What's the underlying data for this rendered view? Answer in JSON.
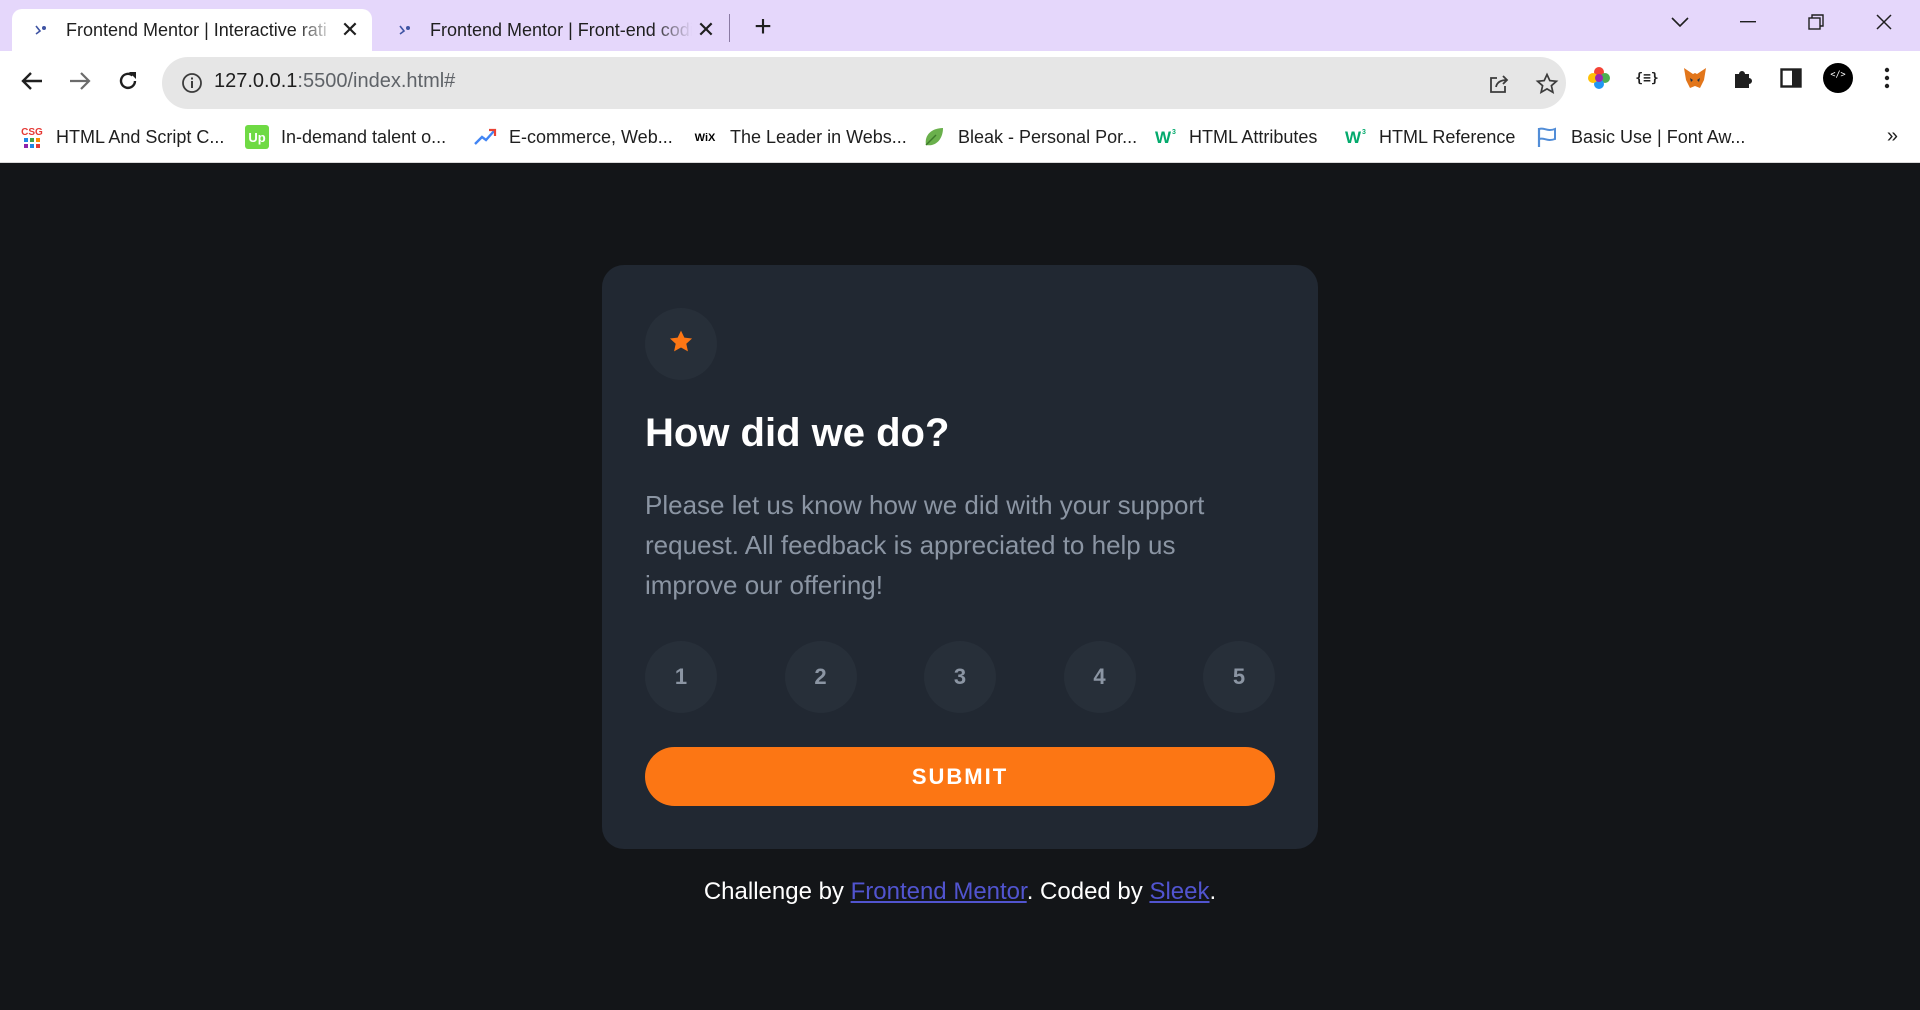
{
  "browser": {
    "tabs": [
      {
        "title": "Frontend Mentor | Interactive rati",
        "active": true
      },
      {
        "title": "Frontend Mentor | Front-end codi",
        "active": false
      }
    ],
    "address_host": "127.0.0.1",
    "address_rest": ":5500/index.html#",
    "bookmarks": [
      {
        "label": "HTML And Script C...",
        "icon": "csg-icon"
      },
      {
        "label": "In-demand talent o...",
        "icon": "upwork-icon"
      },
      {
        "label": "E-commerce, Web...",
        "icon": "trend-icon"
      },
      {
        "label": "The Leader in Webs...",
        "icon": "wix-icon"
      },
      {
        "label": "Bleak - Personal Por...",
        "icon": "leaf-icon"
      },
      {
        "label": "HTML Attributes",
        "icon": "w3schools-icon"
      },
      {
        "label": "HTML Reference",
        "icon": "w3schools-icon"
      },
      {
        "label": "Basic Use | Font Aw...",
        "icon": "flag-icon"
      }
    ],
    "bookmarks_more": "»"
  },
  "card": {
    "title": "How did we do?",
    "description": "Please let us know how we did with your support request. All feedback is appreciated to help us improve our offering!",
    "ratings": [
      "1",
      "2",
      "3",
      "4",
      "5"
    ],
    "submit_label": "SUBMIT"
  },
  "attribution": {
    "prefix": "Challenge by ",
    "link1": "Frontend Mentor",
    "middle": ". Coded by ",
    "link2": "Sleek",
    "suffix": "."
  },
  "colors": {
    "page_bg": "#131518",
    "card_bg": "#212832",
    "accent_orange": "#fc7614",
    "muted_text": "#8b95a3",
    "link": "#5154cf",
    "tabstrip": "#e5d7fb"
  }
}
